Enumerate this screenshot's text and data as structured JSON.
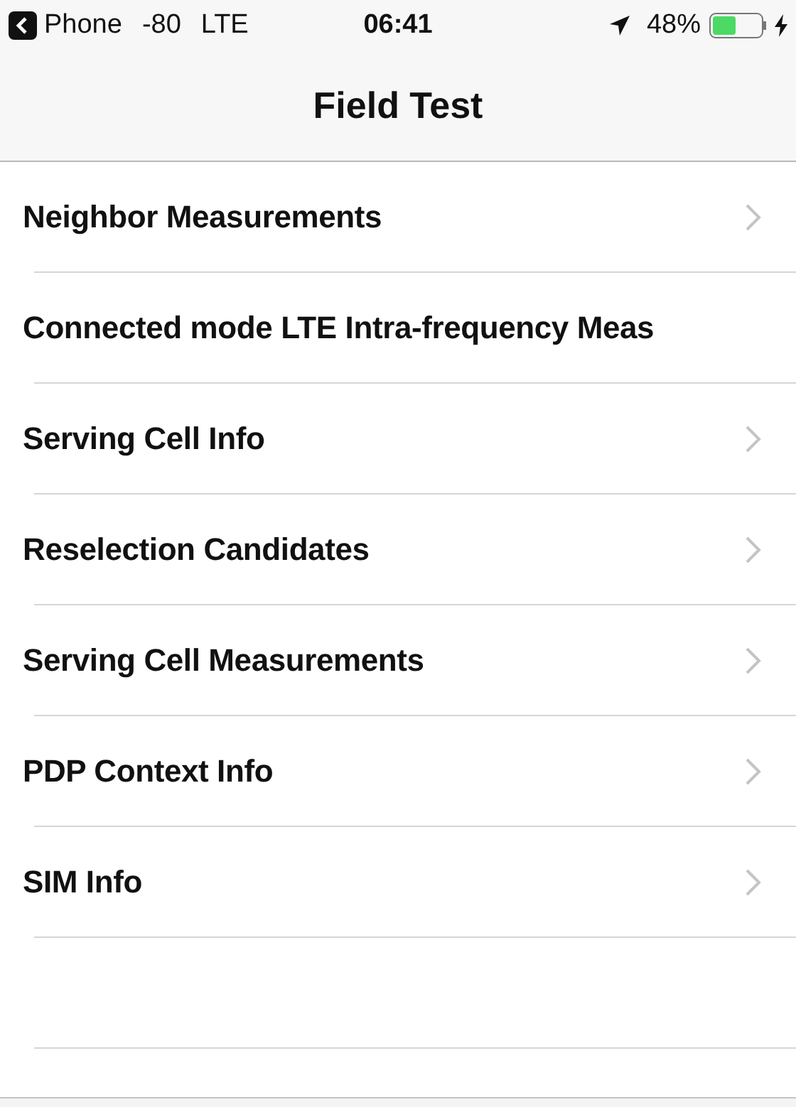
{
  "status_bar": {
    "back_label": "Phone",
    "signal": "-80",
    "network": "LTE",
    "time": "06:41",
    "battery": "48%"
  },
  "nav": {
    "title": "Field Test"
  },
  "rows": [
    {
      "label": "Neighbor Measurements",
      "chevron": true
    },
    {
      "label": "Connected mode LTE Intra-frequency Meas",
      "chevron": false
    },
    {
      "label": "Serving Cell Info",
      "chevron": true
    },
    {
      "label": "Reselection Candidates",
      "chevron": true
    },
    {
      "label": "Serving Cell Measurements",
      "chevron": true
    },
    {
      "label": "PDP Context Info",
      "chevron": true
    },
    {
      "label": "SIM Info",
      "chevron": true
    }
  ]
}
